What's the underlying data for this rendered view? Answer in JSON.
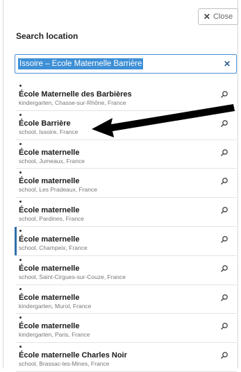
{
  "close_label": "Close",
  "title": "Search location",
  "search": {
    "value": "Issoire – Ecole Maternelle Barrière"
  },
  "results": [
    {
      "name": "École Maternelle des Barbières",
      "detail": "kindergarten, Chasse-sur-Rhône, France"
    },
    {
      "name": "École Barrière",
      "detail": "school, Issoire, France"
    },
    {
      "name": "École maternelle",
      "detail": "school, Jumeaux, France"
    },
    {
      "name": "École maternelle",
      "detail": "school, Les Pradeaux, France"
    },
    {
      "name": "École maternelle",
      "detail": "school, Pardines, France"
    },
    {
      "name": "École maternelle",
      "detail": "school, Champeix, France"
    },
    {
      "name": "École maternelle",
      "detail": "school, Saint-Cirgues-sur-Couze, France"
    },
    {
      "name": "École maternelle",
      "detail": "kindergarten, Murol, France"
    },
    {
      "name": "École maternelle",
      "detail": "kindergarten, Paris, France"
    },
    {
      "name": "École maternelle Charles Noir",
      "detail": "school, Brassac-les-Mines, France"
    }
  ],
  "active_index": 5,
  "icons": {
    "close": "close-icon",
    "clear": "clear-icon",
    "zoom": "zoom-to-location-icon",
    "arrow": "annotation-arrow"
  }
}
